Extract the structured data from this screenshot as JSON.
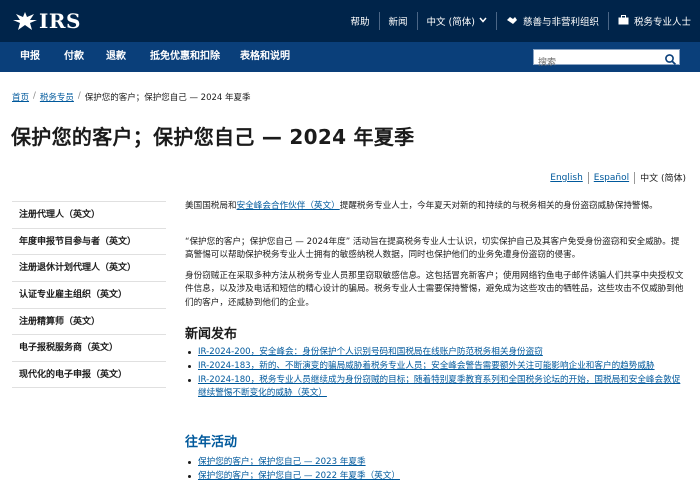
{
  "header": {
    "logo_text": "IRS",
    "links": {
      "help": "帮助",
      "news": "新闻",
      "language": "中文 (简体)",
      "charities": "慈善与非营利组织",
      "tax_pros": "税务专业人士"
    },
    "colors": {
      "top": "#00244a",
      "nav": "#0a3f7a"
    }
  },
  "nav": {
    "items": [
      "申报",
      "付款",
      "退款",
      "抵免优惠和扣除",
      "表格和说明"
    ],
    "search_placeholder": "搜索"
  },
  "breadcrumb": {
    "home": "首页",
    "pros": "税务专员",
    "current": "保护您的客户；保护您自己 — 2024 年夏季"
  },
  "page": {
    "title": "保护您的客户；保护您自己 — 2024 年夏季"
  },
  "languages": {
    "english": "English",
    "spanish": "Español",
    "current": "中文 (简体)"
  },
  "sidebar": {
    "items": [
      "注册代理人（英文）",
      "年度申报节目参与者（英文）",
      "注册退休计划代理人（英文）",
      "认证专业雇主组织（英文）",
      "注册精算师（英文）",
      "电子报税服务商（英文）",
      "现代化的电子申报（英文）"
    ]
  },
  "content": {
    "p1_before": "美国国税局和",
    "p1_link": "安全峰会合作伙伴（英文）",
    "p1_after": "提醒税务专业人士，今年夏天对新的和持续的与税务相关的身份盗窃威胁保持警惕。",
    "p2": "“保护您的客户；保护您自己 — 2024年度” 活动旨在提高税务专业人士认识，切实保护自己及其客户免受身份盗窃和安全威胁。提高警惕可以帮助保护税务专业人士拥有的敏感纳税人数据，同时也保护他们的业务免遭身份盗窃的侵害。",
    "p3": "身份窃贼正在采取多种方法从税务专业人员那里窃取敏感信息。这包括冒充新客户；使用网络钓鱼电子邮件诱骗人们共享中央授权文件信息，以及涉及电话和短信的精心设计的骗局。税务专业人士需要保持警惕，避免成为这些攻击的牺牲品，这些攻击不仅威胁到他们的客户，还威胁到他们的企业。",
    "news_heading": "新闻发布",
    "news": [
      "IR-2024-200，安全峰会：身份保护个人识别号码和国税局在线账户防范税务相关身份盗窃",
      "IR-2024-183，新的、不断演变的骗局威胁着税务专业人员；安全峰会警告需要额外关注可能影响企业和客户的趋势威胁",
      "IR-2024-180，税务专业人员继续成为身份窃贼的目标；随着特别夏季教育系列和全国税务论坛的开始，国税局和安全峰会敦促继续警惕不断变化的威胁（英文）"
    ],
    "past_heading": "往年活动",
    "past": [
      "保护您的客户；保护您自己 — 2023 年夏季",
      "保护您的客户；保护您自己 — 2022 年夏季（英文）"
    ]
  }
}
